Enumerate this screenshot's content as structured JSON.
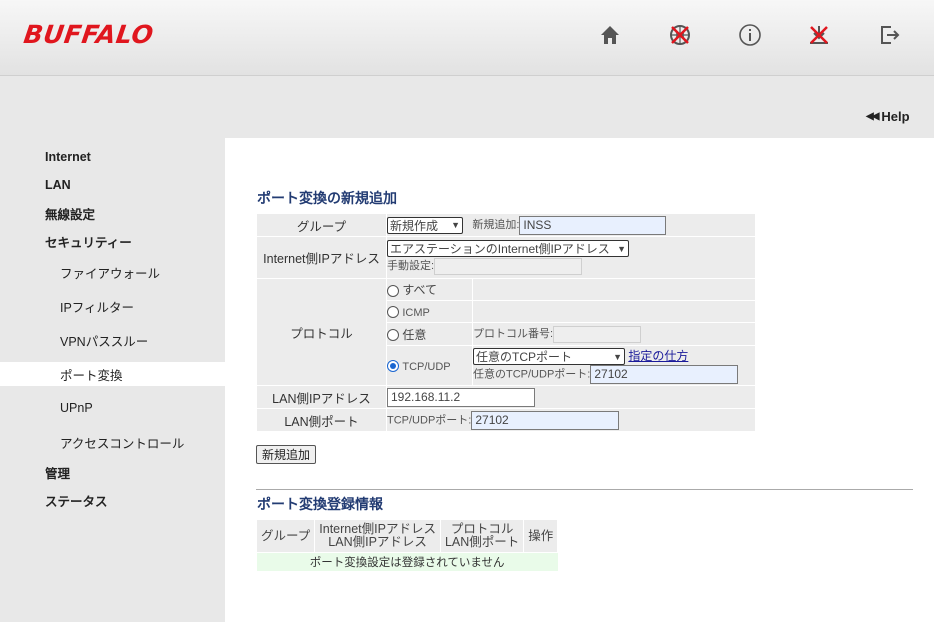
{
  "header": {
    "logo": "BUFFALO",
    "help": "Help"
  },
  "nav": [
    {
      "label": "Internet",
      "sub": false,
      "active": false
    },
    {
      "label": "LAN",
      "sub": false,
      "active": false
    },
    {
      "label": "無線設定",
      "sub": false,
      "active": false
    },
    {
      "label": "セキュリティー",
      "sub": false,
      "active": false
    },
    {
      "label": "ファイアウォール",
      "sub": true,
      "active": false
    },
    {
      "label": "IPフィルター",
      "sub": true,
      "active": false
    },
    {
      "label": "VPNパススルー",
      "sub": true,
      "active": false
    },
    {
      "label": "ポート変換",
      "sub": true,
      "active": true
    },
    {
      "label": "UPnP",
      "sub": true,
      "active": false
    },
    {
      "label": "アクセスコントロール",
      "sub": true,
      "active": false
    },
    {
      "label": "管理",
      "sub": false,
      "active": false
    },
    {
      "label": "ステータス",
      "sub": false,
      "active": false
    }
  ],
  "form": {
    "title": "ポート変換の新規追加",
    "group_label": "グループ",
    "group_select": "新規作成",
    "group_new_label": "新規追加:",
    "group_new_value": "INSS",
    "internet_ip_label": "Internet側IPアドレス",
    "internet_ip_select": "エアステーションのInternet側IPアドレス",
    "manual_label": "手動設定:",
    "manual_value": "",
    "protocol_label": "プロトコル",
    "proto_all": "すべて",
    "proto_icmp": "ICMP",
    "proto_any": "任意",
    "proto_number_label": "プロトコル番号:",
    "proto_number_value": "",
    "proto_tcpudp": "TCP/UDP",
    "tcp_port_select": "任意のTCPポート",
    "howto_link": "指定の仕方",
    "any_port_label": "任意のTCP/UDPポート:",
    "any_port_value": "27102",
    "lan_ip_label": "LAN側IPアドレス",
    "lan_ip_value": "192.168.11.2",
    "lan_port_label": "LAN側ポート",
    "lan_port_field_label": "TCP/UDPポート:",
    "lan_port_value": "27102",
    "add_button": "新規追加"
  },
  "registry": {
    "title": "ポート変換登録情報",
    "col_group": "グループ",
    "col_ip_1": "Internet側IPアドレス",
    "col_ip_2": "LAN側IPアドレス",
    "col_proto_1": "プロトコル",
    "col_proto_2": "LAN側ポート",
    "col_op": "操作",
    "empty": "ポート変換設定は登録されていません"
  }
}
